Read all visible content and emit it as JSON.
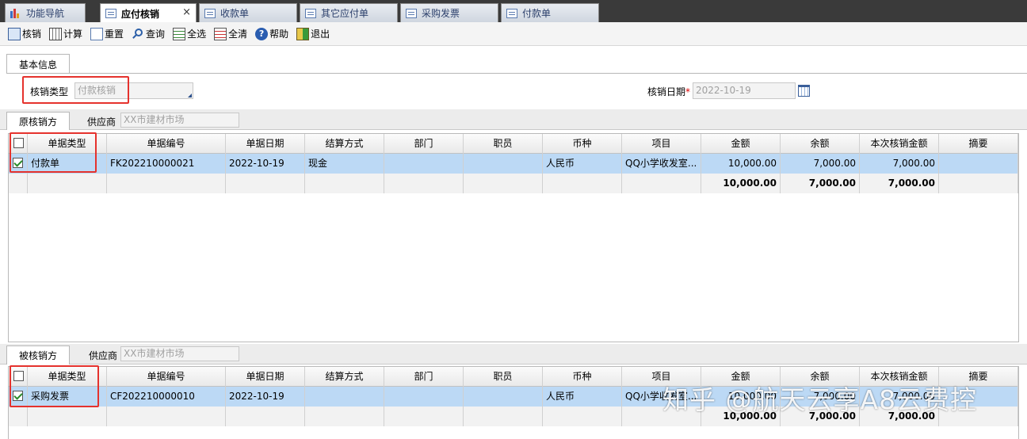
{
  "tabs": [
    {
      "label": "功能导航",
      "icon": "bar-chart-icon"
    },
    {
      "label": "应付核销",
      "icon": "document-icon",
      "active": true
    },
    {
      "label": "收款单",
      "icon": "document-icon"
    },
    {
      "label": "其它应付单",
      "icon": "document-icon"
    },
    {
      "label": "采购发票",
      "icon": "document-icon"
    },
    {
      "label": "付款单",
      "icon": "document-icon"
    }
  ],
  "tab_close": "×",
  "toolbar": [
    {
      "label": "核销",
      "icon": "verify-icon"
    },
    {
      "label": "计算",
      "icon": "calculator-icon"
    },
    {
      "label": "重置",
      "icon": "reset-icon"
    },
    {
      "label": "查询",
      "icon": "search-icon"
    },
    {
      "label": "全选",
      "icon": "select-all-icon"
    },
    {
      "label": "全清",
      "icon": "clear-all-icon"
    },
    {
      "label": "帮助",
      "icon": "help-icon"
    },
    {
      "label": "退出",
      "icon": "exit-icon"
    }
  ],
  "basic_info": {
    "tab_label": "基本信息",
    "type_label": "核销类型",
    "type_value": "付款核销",
    "date_label": "核销日期",
    "required_mark": "*",
    "date_value": "2022-10-19"
  },
  "columns": [
    "单据类型",
    "单据编号",
    "单据日期",
    "结算方式",
    "部门",
    "职员",
    "币种",
    "项目",
    "金额",
    "余额",
    "本次核销金额",
    "摘要"
  ],
  "source": {
    "tab_label": "原核销方",
    "supplier_label": "供应商",
    "supplier_value": "XX市建材市场",
    "rows": [
      {
        "type": "付款单",
        "no": "FK202210000021",
        "date": "2022-10-19",
        "settle": "现金",
        "dept": "",
        "staff": "",
        "currency": "人民币",
        "project": "QQ小学收发室...",
        "amount": "10,000.00",
        "balance": "7,000.00",
        "this": "7,000.00",
        "memo": ""
      }
    ],
    "totals": {
      "amount": "10,000.00",
      "balance": "7,000.00",
      "this": "7,000.00"
    }
  },
  "target": {
    "tab_label": "被核销方",
    "supplier_label": "供应商",
    "supplier_value": "XX市建材市场",
    "rows": [
      {
        "type": "采购发票",
        "no": "CF202210000010",
        "date": "2022-10-19",
        "settle": "",
        "dept": "",
        "staff": "",
        "currency": "人民币",
        "project": "QQ小学收发室...",
        "amount": "10,000.00",
        "balance": "7,000.00",
        "this": "7,000.00",
        "memo": ""
      }
    ],
    "totals": {
      "amount": "10,000.00",
      "balance": "7,000.00",
      "this": "7,000.00"
    }
  },
  "watermark": "知乎 @航天云享A8云费控",
  "colors": {
    "highlight": "#e5322d",
    "selected_row": "#bcd9f5",
    "tabbar": "#3a3a3a"
  }
}
